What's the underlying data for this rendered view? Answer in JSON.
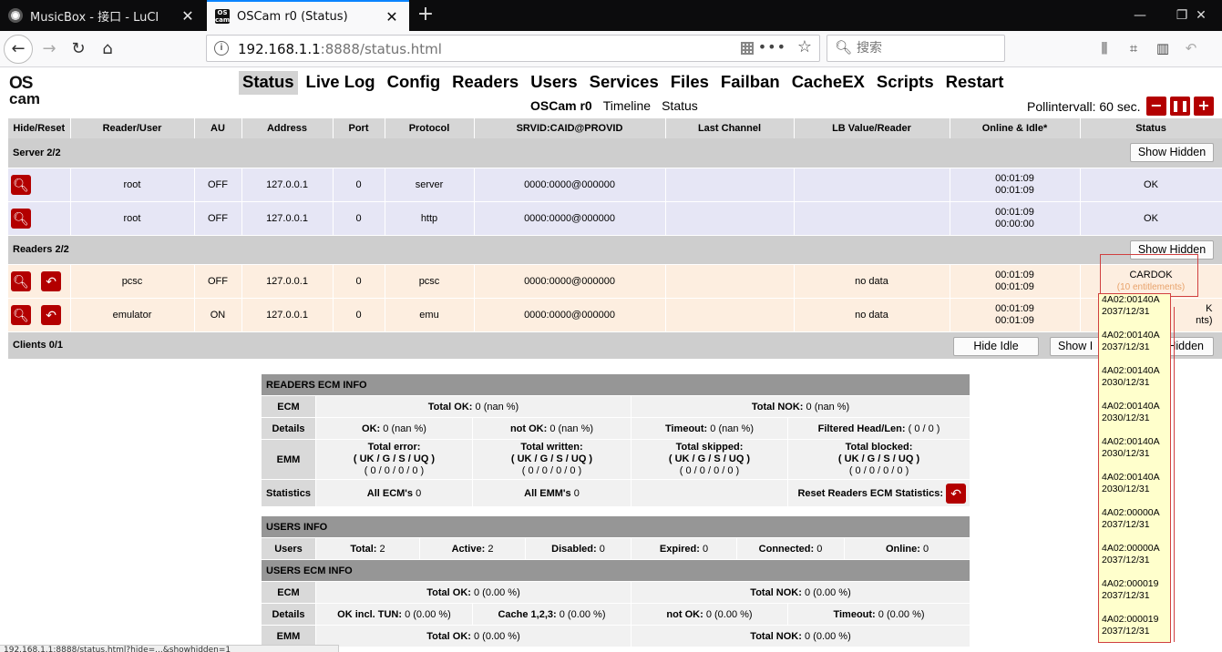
{
  "browser": {
    "tabs": [
      {
        "title": "MusicBox - 接口 - LuCI"
      },
      {
        "title": "OSCam r0 (Status)"
      }
    ],
    "url_host": "192.168.1.1",
    "url_rest": ":8888/status.html",
    "search_placeholder": "搜索",
    "status_url": "192.168.1.1:8888/status.html?hide=...&showhidden=1"
  },
  "menu": {
    "items": [
      "Status",
      "Live Log",
      "Config",
      "Readers",
      "Users",
      "Services",
      "Files",
      "Failban",
      "CacheEX",
      "Scripts",
      "Restart"
    ],
    "active": "Status"
  },
  "submenu": {
    "current": "OSCam r0",
    "timeline": "Timeline",
    "status": "Status"
  },
  "poll": {
    "label": "Pollintervall: 60 sec."
  },
  "status_table": {
    "headers": [
      "Hide/Reset",
      "Reader/User",
      "AU",
      "Address",
      "Port",
      "Protocol",
      "SRVID:CAID@PROVID",
      "Last Channel",
      "LB Value/Reader",
      "Online & Idle*",
      "Status"
    ],
    "server_group": "Server 2/2",
    "servers": [
      {
        "user": "root",
        "au": "OFF",
        "address": "127.0.0.1",
        "port": "0",
        "protocol": "server",
        "srvid": "0000:0000@000000",
        "online": "00:01:09",
        "idle": "00:01:09",
        "status": "OK"
      },
      {
        "user": "root",
        "au": "OFF",
        "address": "127.0.0.1",
        "port": "0",
        "protocol": "http",
        "srvid": "0000:0000@000000",
        "online": "00:01:09",
        "idle": "00:00:00",
        "status": "OK"
      }
    ],
    "readers_group": "Readers 2/2",
    "readers": [
      {
        "user": "pcsc",
        "au": "OFF",
        "address": "127.0.0.1",
        "port": "0",
        "protocol": "pcsc",
        "srvid": "0000:0000@000000",
        "lb": "no data",
        "online": "00:01:09",
        "idle": "00:01:09",
        "status": "CARDOK",
        "entitlements": "(10 entitlements)"
      },
      {
        "user": "emulator",
        "au": "ON",
        "address": "127.0.0.1",
        "port": "0",
        "protocol": "emu",
        "srvid": "0000:0000@000000",
        "lb": "no data",
        "online": "00:01:09",
        "idle": "00:01:09",
        "status_tail": "K",
        "entitlements_tail": "nts)"
      }
    ],
    "clients_group": "Clients 0/1",
    "show_hidden": "Show Hidden",
    "hide_idle": "Hide Idle",
    "show_idle_partial": "Show I"
  },
  "readers_ecm": {
    "title": "READERS ECM INFO",
    "ecm_label": "ECM",
    "total_ok_label": "Total OK:",
    "total_ok_value": "0 (nan %)",
    "total_nok_label": "Total NOK:",
    "total_nok_value": "0 (nan %)",
    "details_label": "Details",
    "ok_label": "OK:",
    "ok_value": "0 (nan %)",
    "notok_label": "not OK:",
    "notok_value": "0 (nan %)",
    "timeout_label": "Timeout:",
    "timeout_value": "0 (nan %)",
    "filtered_label": "Filtered Head/Len:",
    "filtered_value": "( 0 / 0 )",
    "emm_label": "EMM",
    "emm_cells": [
      {
        "title": "Total error:",
        "sub": "( UK / G / S / UQ )",
        "vals": "( 0 / 0 / 0 / 0 )"
      },
      {
        "title": "Total written:",
        "sub": "( UK / G / S / UQ )",
        "vals": "( 0 / 0 / 0 / 0 )"
      },
      {
        "title": "Total skipped:",
        "sub": "( UK / G / S / UQ )",
        "vals": "( 0 / 0 / 0 / 0 )"
      },
      {
        "title": "Total blocked:",
        "sub": "( UK / G / S / UQ )",
        "vals": "( 0 / 0 / 0 / 0 )"
      }
    ],
    "stats_label": "Statistics",
    "all_ecm_label": "All ECM's",
    "all_ecm_value": "0",
    "all_emm_label": "All EMM's",
    "all_emm_value": "0",
    "reset_label": "Reset Readers ECM Statistics:"
  },
  "users_info": {
    "title": "USERS INFO",
    "users_label": "Users",
    "total_label": "Total:",
    "total_value": "2",
    "active_label": "Active:",
    "active_value": "2",
    "disabled_label": "Disabled:",
    "disabled_value": "0",
    "expired_label": "Expired:",
    "expired_value": "0",
    "connected_label": "Connected:",
    "connected_value": "0",
    "online_label": "Online:",
    "online_value": "0"
  },
  "users_ecm": {
    "title": "USERS ECM INFO",
    "ecm_label": "ECM",
    "total_ok_label": "Total OK:",
    "total_ok_value": "0 (0.00 %)",
    "total_nok_label": "Total NOK:",
    "total_nok_value": "0 (0.00 %)",
    "details_label": "Details",
    "okt_label": "OK incl. TUN:",
    "okt_value": "0 (0.00 %)",
    "cache_label": "Cache 1,2,3:",
    "cache_value": "0 (0.00 %)",
    "notok_label": "not OK:",
    "notok_value": "0 (0.00 %)",
    "timeout_label": "Timeout:",
    "timeout_value": "0 (0.00 %)",
    "emm_label": "EMM",
    "emm_ok_label": "Total OK:",
    "emm_ok_value": "0 (0.00 %)",
    "emm_nok_label": "Total NOK:",
    "emm_nok_value": "0 (0.00 %)"
  },
  "tooltip": {
    "entitlements": [
      {
        "id": "4A02:00140A",
        "date": "2037/12/31"
      },
      {
        "id": "4A02:00140A",
        "date": "2037/12/31"
      },
      {
        "id": "4A02:00140A",
        "date": "2030/12/31"
      },
      {
        "id": "4A02:00140A",
        "date": "2030/12/31"
      },
      {
        "id": "4A02:00140A",
        "date": "2030/12/31"
      },
      {
        "id": "4A02:00140A",
        "date": "2030/12/31"
      },
      {
        "id": "4A02:00000A",
        "date": "2037/12/31"
      },
      {
        "id": "4A02:00000A",
        "date": "2037/12/31"
      },
      {
        "id": "4A02:000019",
        "date": "2037/12/31"
      },
      {
        "id": "4A02:000019",
        "date": "2037/12/31"
      }
    ]
  },
  "colors": {
    "accent_red": "#b30000",
    "server_row": "#e6e6f5",
    "reader_row": "#fdeee0",
    "group_row": "#cecece",
    "tooltip_bg": "#ffffcc"
  }
}
